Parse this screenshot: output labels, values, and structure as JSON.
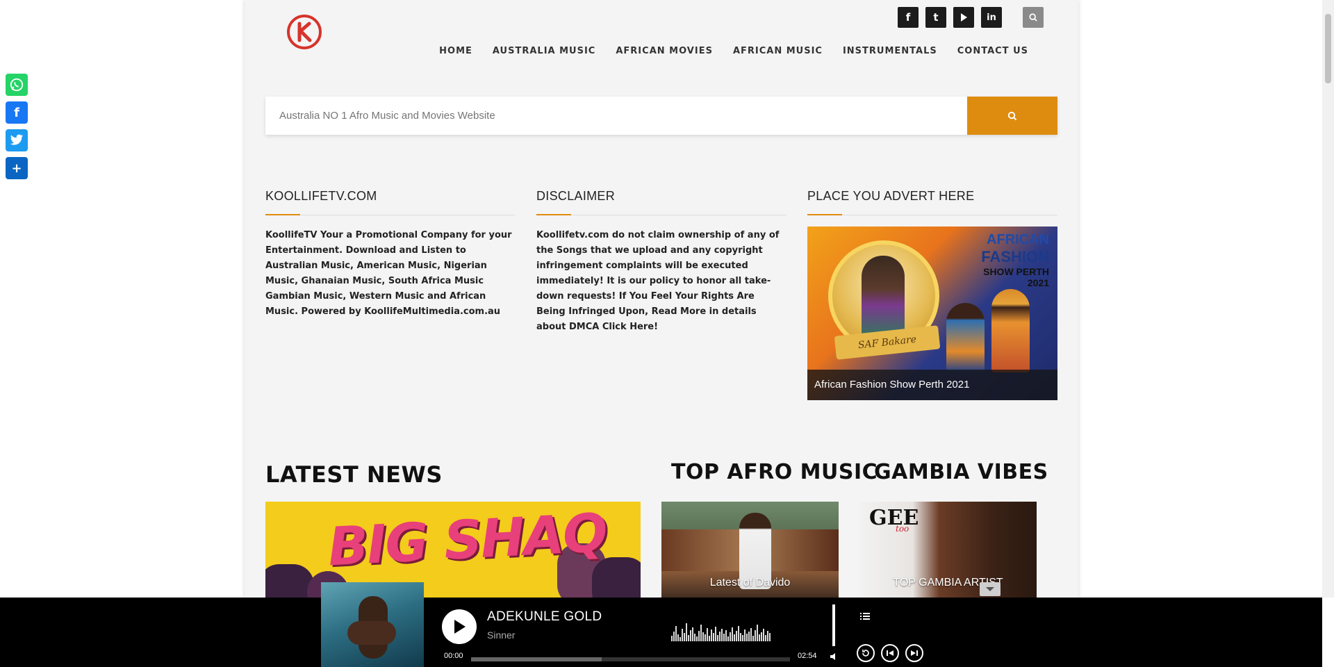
{
  "header": {
    "nav": [
      "HOME",
      "AUSTRALIA MUSIC",
      "AFRICAN MOVIES",
      "AFRICAN MUSIC",
      "INSTRUMENTALS",
      "CONTACT US"
    ]
  },
  "search": {
    "placeholder": "Australia NO 1 Afro Music and Movies Website"
  },
  "widgets": [
    {
      "title": "KOOLLIFETV.COM",
      "text": "KoollifeTV Your a Promotional Company for your Entertainment. Download and Listen to Australian Music, American Music, Nigerian Music, Ghanaian Music, South Africa Music Gambian Music, Western Music and African Music. Powered by KoollifeMultimedia.com.au"
    },
    {
      "title": "DISCLAIMER",
      "text": "Koollifetv.com do not claim ownership of any of the Songs that we upload and any copyright infringement complaints will be executed immediately! It is our policy to honor all take-down requests! If You Feel Your Rights Are Being Infringed Upon, Read More in details about DMCA Click Here!"
    },
    {
      "title": "PLACE YOU ADVERT HERE",
      "caption": "African Fashion Show Perth 2021"
    }
  ],
  "ad_image": {
    "line1": "AFRICAN",
    "line2": "FASHION",
    "line3": "SHOW PERTH",
    "line4": "2021",
    "ribbon": "SAF Bakare"
  },
  "sections": {
    "latest_news": "LATEST NEWS",
    "top_afro": "TOP AFRO MUSIC",
    "gambia": "GAMBIA VIBES"
  },
  "cards": {
    "bigshaq_art": "BIG SHAQ",
    "davido": "Latest of Davido",
    "gambia": "TOP GAMBIA ARTIST",
    "gee": "GEE",
    "gee_tag": "too"
  },
  "player": {
    "artist": "ADEKUNLE GOLD",
    "song": "Sinner",
    "time_current": "00:00",
    "time_total": "02:54",
    "progress": 0.41
  }
}
